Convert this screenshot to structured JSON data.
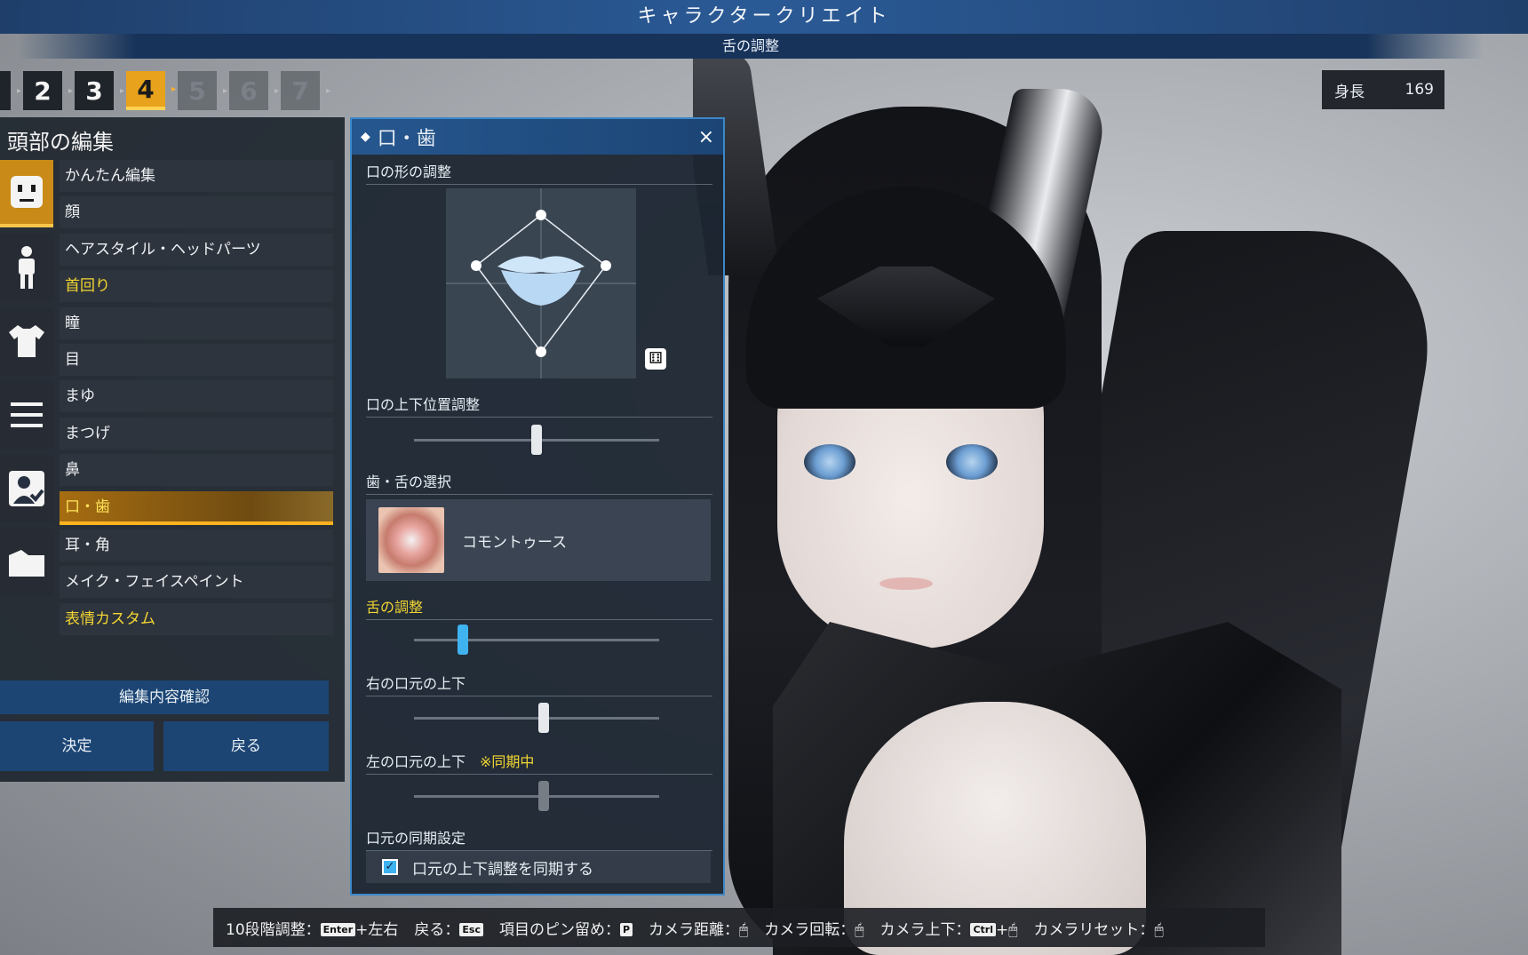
{
  "header": {
    "title": "キャラクタークリエイト",
    "subtitle": "舌の調整"
  },
  "steps": [
    {
      "label": "2",
      "state": "done"
    },
    {
      "label": "3",
      "state": "done"
    },
    {
      "label": "4",
      "state": "active"
    },
    {
      "label": "5",
      "state": "disabled"
    },
    {
      "label": "6",
      "state": "disabled"
    },
    {
      "label": "7",
      "state": "disabled"
    }
  ],
  "height": {
    "label": "身長",
    "value": "169"
  },
  "left_panel": {
    "title": "頭部の編集",
    "categories": [
      "face-icon",
      "body-icon",
      "shirt-icon",
      "menu-lines-icon",
      "person-check-icon",
      "folder-icon"
    ],
    "menu": [
      {
        "label": "かんたん編集"
      },
      {
        "label": "顔"
      },
      {
        "label": "ヘアスタイル・ヘッドパーツ"
      },
      {
        "label": "首回り"
      },
      {
        "label": "瞳"
      },
      {
        "label": "目"
      },
      {
        "label": "まゆ"
      },
      {
        "label": "まつげ"
      },
      {
        "label": "鼻"
      },
      {
        "label": "口・歯"
      },
      {
        "label": "耳・角"
      },
      {
        "label": "メイク・フェイスペイント"
      },
      {
        "label": "表情カスタム"
      }
    ],
    "confirm_label": "編集内容確認",
    "ok_label": "決定",
    "back_label": "戻る"
  },
  "mouth_panel": {
    "title": "口・歯",
    "close": "×",
    "shape_section": "口の形の調整",
    "dice": "⚅",
    "vertical_section": "口の上下位置調整",
    "vertical_value": 0.5,
    "teeth_section": "歯・舌の選択",
    "teeth_value": "コモントゥース",
    "tongue_section": "舌の調整",
    "tongue_value": 0.2,
    "right_corner_section": "右の口元の上下",
    "right_corner_value": 0.53,
    "left_corner_section": "左の口元の上下",
    "sync_note": "※同期中",
    "left_corner_value": 0.53,
    "sync_section": "口元の同期設定",
    "sync_checkbox_label": "口元の上下調整を同期する",
    "sync_checked": true
  },
  "help_bar": {
    "items": [
      {
        "text": "10段階調整：",
        "key": "Enter",
        "suffix": "+左右"
      },
      {
        "text": "戻る：",
        "key": "Esc",
        "suffix": ""
      },
      {
        "text": "項目のピン留め：",
        "key": "P",
        "suffix": ""
      },
      {
        "text": "カメラ距離：",
        "key": "🖱",
        "suffix": ""
      },
      {
        "text": "カメラ回転：",
        "key": "🖱",
        "suffix": ""
      },
      {
        "text": "カメラ上下：",
        "key": "Ctrl",
        "suffix": "+🖱"
      },
      {
        "text": "カメラリセット：",
        "key": "🖱",
        "suffix": ""
      }
    ]
  }
}
